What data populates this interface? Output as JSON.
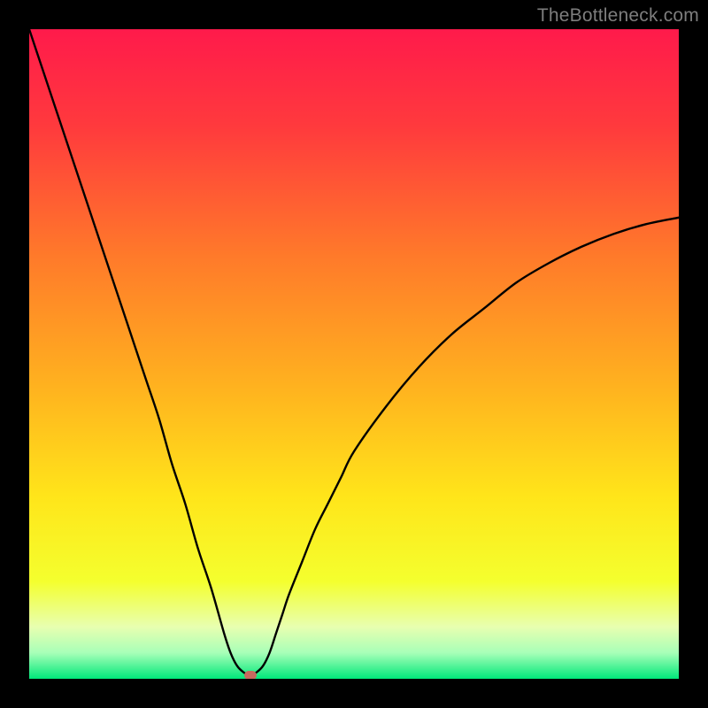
{
  "watermark": "TheBottleneck.com",
  "colors": {
    "gradient_stops": [
      {
        "offset": "0%",
        "color": "#ff1a4b"
      },
      {
        "offset": "15%",
        "color": "#ff3a3d"
      },
      {
        "offset": "35%",
        "color": "#ff7a2a"
      },
      {
        "offset": "55%",
        "color": "#ffb21f"
      },
      {
        "offset": "72%",
        "color": "#ffe51a"
      },
      {
        "offset": "85%",
        "color": "#f4ff2e"
      },
      {
        "offset": "92%",
        "color": "#e8ffb0"
      },
      {
        "offset": "96%",
        "color": "#a8ffb8"
      },
      {
        "offset": "100%",
        "color": "#00e87a"
      }
    ],
    "curve": "#000000",
    "marker": "#c66a5e",
    "frame": "#000000"
  },
  "chart_data": {
    "type": "line",
    "title": "",
    "xlabel": "",
    "ylabel": "",
    "xlim": [
      0,
      100
    ],
    "ylim": [
      0,
      100
    ],
    "series": [
      {
        "name": "bottleneck-curve",
        "x": [
          0,
          2,
          4,
          6,
          8,
          10,
          12,
          14,
          16,
          18,
          20,
          22,
          24,
          26,
          28,
          30,
          31,
          32,
          33,
          34,
          35,
          36,
          37,
          38,
          39,
          40,
          42,
          44,
          46,
          48,
          50,
          55,
          60,
          65,
          70,
          75,
          80,
          85,
          90,
          95,
          100
        ],
        "y": [
          100,
          94,
          88,
          82,
          76,
          70,
          64,
          58,
          52,
          46,
          40,
          33,
          27,
          20,
          14,
          7,
          4,
          2,
          1,
          0.5,
          1,
          2,
          4,
          7,
          10,
          13,
          18,
          23,
          27,
          31,
          35,
          42,
          48,
          53,
          57,
          61,
          64,
          66.5,
          68.5,
          70,
          71
        ]
      }
    ],
    "annotations": [
      {
        "name": "optimal-point",
        "x": 34,
        "y": 0.5
      }
    ]
  }
}
